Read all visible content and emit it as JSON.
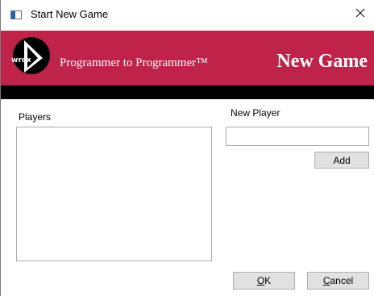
{
  "window": {
    "title": "Start New Game",
    "icon": "window-app-icon",
    "close_icon": "close-icon"
  },
  "banner": {
    "logo_text": "wrox",
    "tagline": "Programmer to Programmer™",
    "title": "New Game",
    "colors": {
      "banner": "#c0234a",
      "bar": "#000000"
    }
  },
  "players": {
    "label": "Players",
    "items": []
  },
  "new_player": {
    "label": "New Player",
    "value": "",
    "add_label": "Add"
  },
  "buttons": {
    "ok_mnemonic": "O",
    "ok_rest": "K",
    "cancel_mnemonic": "C",
    "cancel_rest": "ancel"
  }
}
